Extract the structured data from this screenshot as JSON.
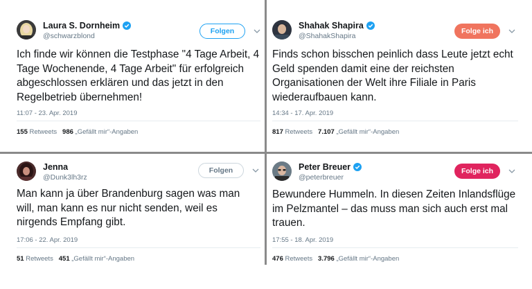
{
  "tweets": [
    {
      "name": "Laura S. Dornheim",
      "handle": "@schwarzblond",
      "button": "Folgen",
      "text": "Ich finde wir können die Testphase \"4 Tage Arbeit, 4 Tage Wochenende, 4 Tage Arbeit\" für erfolgreich abgeschlossen erklären und das jetzt in den Regelbetrieb übernehmen!",
      "timestamp": "11:07 - 23. Apr. 2019",
      "retweets": "155",
      "retweets_label": "Retweets",
      "likes": "986",
      "likes_label": "„Gefällt mir“-Angaben"
    },
    {
      "name": "Shahak Shapira",
      "handle": "@ShahakShapira",
      "button": "Folge ich",
      "text": "Finds schon bisschen peinlich dass Leute jetzt echt Geld spenden damit eine der reichsten Organisationen der Welt ihre Filiale in Paris wiederaufbauen kann.",
      "timestamp": "14:34 - 17. Apr. 2019",
      "retweets": "817",
      "retweets_label": "Retweets",
      "likes": "7.107",
      "likes_label": "„Gefällt mir“-Angaben"
    },
    {
      "name": "Jenna",
      "handle": "@Dunk3lh3rz",
      "button": "Folgen",
      "text": "Man kann ja über Brandenburg sagen was man will, man kann es nur nicht senden, weil es nirgends Empfang gibt.",
      "timestamp": "17:06 - 22. Apr. 2019",
      "retweets": "51",
      "retweets_label": "Retweets",
      "likes": "451",
      "likes_label": "„Gefällt mir“-Angaben"
    },
    {
      "name": "Peter Breuer",
      "handle": "@peterbreuer",
      "button": "Folge ich",
      "text": "Bewundere Hummeln. In diesen Zeiten Inlandsflüge im Pelzmantel – das muss man sich auch erst mal trauen.",
      "timestamp": "17:55 - 18. Apr. 2019",
      "retweets": "476",
      "retweets_label": "Retweets",
      "likes": "3.796",
      "likes_label": "„Gefällt mir“-Angaben"
    }
  ],
  "colors": {
    "twitter_blue": "#1da1f2",
    "following_red": "#e0245e",
    "text_primary": "#14171a",
    "text_secondary": "#657786",
    "divider": "#8a8a8a"
  },
  "icons": {
    "verified": "verified-badge-icon",
    "caret": "chevron-down-icon"
  }
}
